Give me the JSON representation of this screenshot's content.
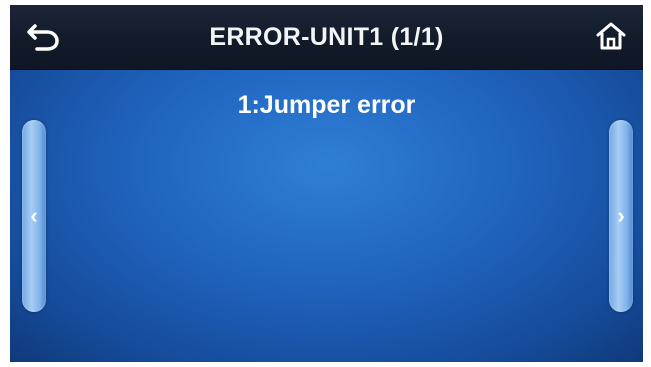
{
  "header": {
    "title": "ERROR-UNIT1 (1/1)",
    "back_icon": "back-arrow-icon",
    "home_icon": "home-icon"
  },
  "main": {
    "error_message": "1:Jumper error"
  },
  "navigation": {
    "prev_glyph": "‹",
    "next_glyph": "›"
  },
  "colors": {
    "header_bg": "#141c2c",
    "screen_bg": "#1f62bd",
    "handle": "#a9cdf3",
    "text": "#ffffff"
  }
}
